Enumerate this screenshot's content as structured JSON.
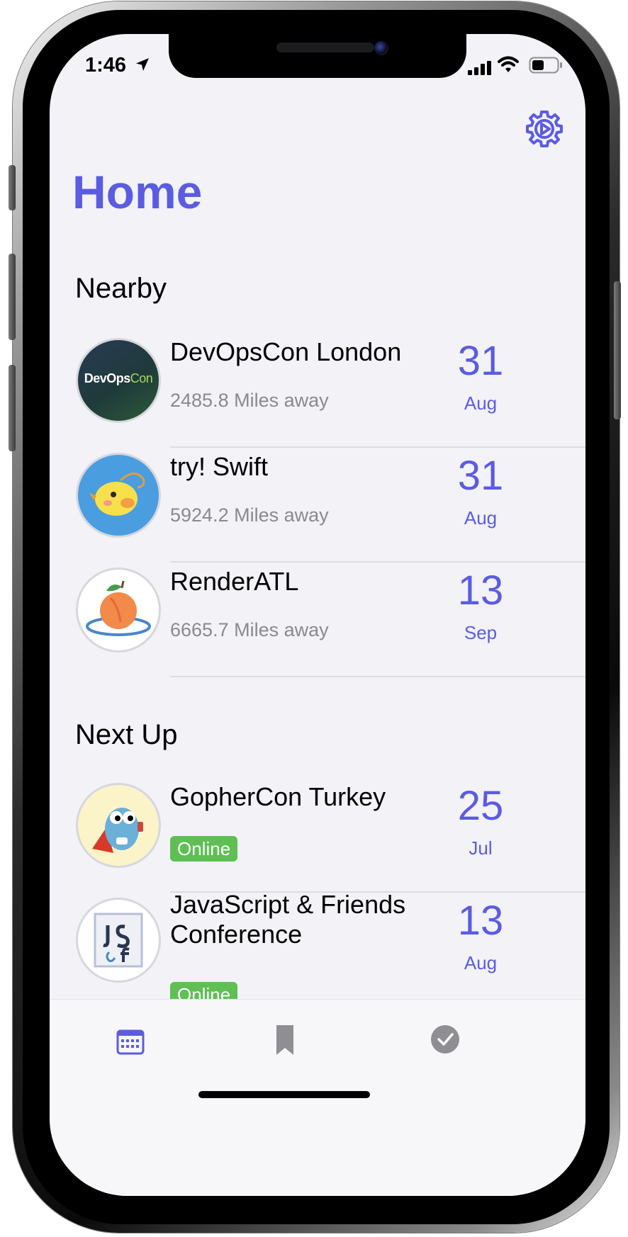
{
  "status_bar": {
    "time": "1:46"
  },
  "header": {
    "title": "Home"
  },
  "sections": {
    "nearby": "Nearby",
    "next_up": "Next Up"
  },
  "nearby": [
    {
      "name": "DevOpsCon London",
      "distance": "2485.8 Miles away",
      "day": "31",
      "month": "Aug",
      "logo_text": "DevOps",
      "logo_text2": "Con"
    },
    {
      "name": "try! Swift",
      "distance": "5924.2 Miles away",
      "day": "31",
      "month": "Aug"
    },
    {
      "name": "RenderATL",
      "distance": "6665.7 Miles away",
      "day": "13",
      "month": "Sep"
    }
  ],
  "next_up": [
    {
      "name": "GopherCon Turkey",
      "badge": "Online",
      "day": "25",
      "month": "Jul"
    },
    {
      "name": "JavaScript & Friends Conference",
      "badge": "Online",
      "day": "13",
      "month": "Aug"
    }
  ],
  "tabs": [
    {
      "icon": "calendar-icon",
      "active": true
    },
    {
      "icon": "bookmark-icon",
      "active": false
    },
    {
      "icon": "checkmark-circle-icon",
      "active": false
    }
  ],
  "colors": {
    "accent": "#5b5ce2",
    "online": "#5fbf54",
    "secondary_text": "#8a8a8e",
    "background": "#f2f2f7"
  }
}
